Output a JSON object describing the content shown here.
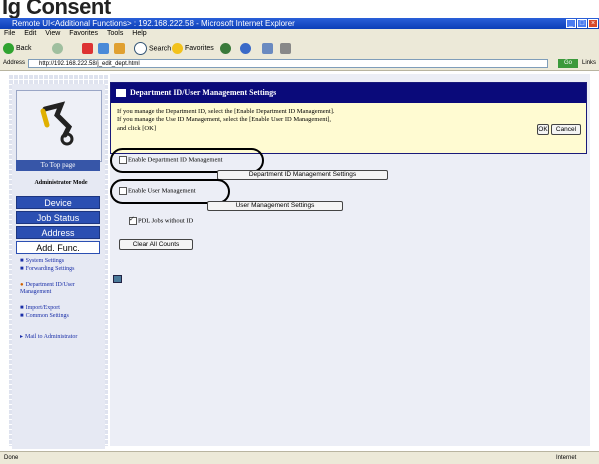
{
  "page_heading": "Ig Consent",
  "window": {
    "title": "Remote UI<Additional Functions> : 192.168.222.58 - Microsoft Internet Explorer",
    "buttons": [
      "_",
      "□",
      "×"
    ]
  },
  "menu": [
    "File",
    "Edit",
    "View",
    "Favorites",
    "Tools",
    "Help"
  ],
  "toolbar": {
    "back": "Back",
    "search": "Search",
    "favorites": "Favorites"
  },
  "address": {
    "label": "Address",
    "url": "http://192.168.222.58/j_edit_dept.html",
    "go": "Go",
    "links": "Links"
  },
  "sidebar": {
    "to_top": "To Top page",
    "admin_mode": "Administrator Mode",
    "nav": [
      "Device",
      "Job Status",
      "Address",
      "Add. Func."
    ],
    "links": [
      "System Settings",
      "Forwarding Settings",
      "Department ID/User Management",
      "Import/Export",
      "Common Settings"
    ],
    "mail": "Mail to Administrator"
  },
  "panel": {
    "title": "Department ID/User Management Settings",
    "instructions": [
      "If you manage the Department ID, select the [Enable Department ID Management].",
      "If you manage the Use ID Management, select the [Enable User ID Management],",
      "and click [OK]"
    ],
    "ok": "OK",
    "cancel": "Cancel"
  },
  "settings": {
    "dept_checkbox": "Enable Department ID Management",
    "dept_button": "Department ID Management Settings",
    "user_checkbox": "Enable User Management",
    "user_button": "User Management Settings",
    "pdl_checkbox": "PDL Jobs without ID",
    "clear_button": "Clear All Counts"
  },
  "status": {
    "left": "Done",
    "right": "Internet"
  }
}
